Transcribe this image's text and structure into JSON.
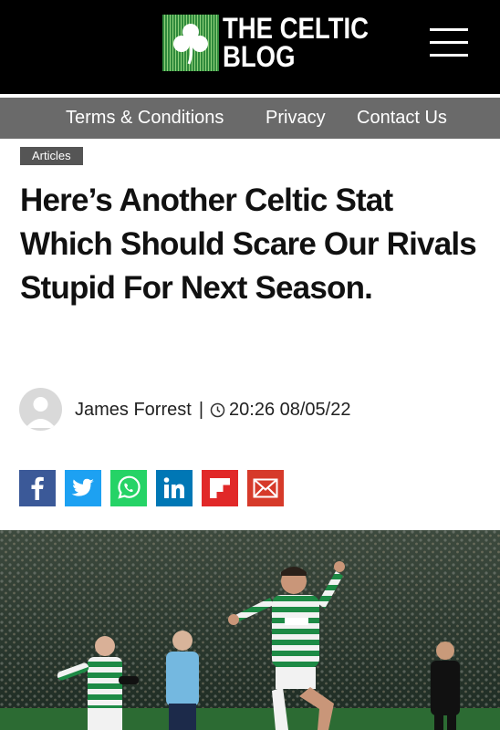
{
  "header": {
    "logo_line1": "THE CELTIC",
    "logo_line2": "BLOG",
    "logo_icon": "shamrock-icon",
    "menu_icon": "hamburger-menu-icon"
  },
  "nav": {
    "items": [
      {
        "label": "Terms & Conditions"
      },
      {
        "label": "Privacy"
      },
      {
        "label": "Contact Us"
      }
    ]
  },
  "article": {
    "category": "Articles",
    "title": "Here’s Another Celtic Stat Which Should Scare Our Rivals Stupid For Next Season.",
    "author": "James Forrest",
    "separator": "|",
    "time": "20:26 08/05/22",
    "share_icons": [
      {
        "name": "facebook-icon",
        "color": "#3b5998"
      },
      {
        "name": "twitter-icon",
        "color": "#1da1f2"
      },
      {
        "name": "whatsapp-icon",
        "color": "#25d366"
      },
      {
        "name": "linkedin-icon",
        "color": "#0077b5"
      },
      {
        "name": "flipboard-icon",
        "color": "#e12828"
      },
      {
        "name": "email-icon",
        "color": "#d63a2a"
      }
    ]
  },
  "colors": {
    "header_bg": "#000000",
    "nav_bg": "#6a6a6a",
    "tag_bg": "#555555",
    "logo_green": "#2f8a3c"
  }
}
